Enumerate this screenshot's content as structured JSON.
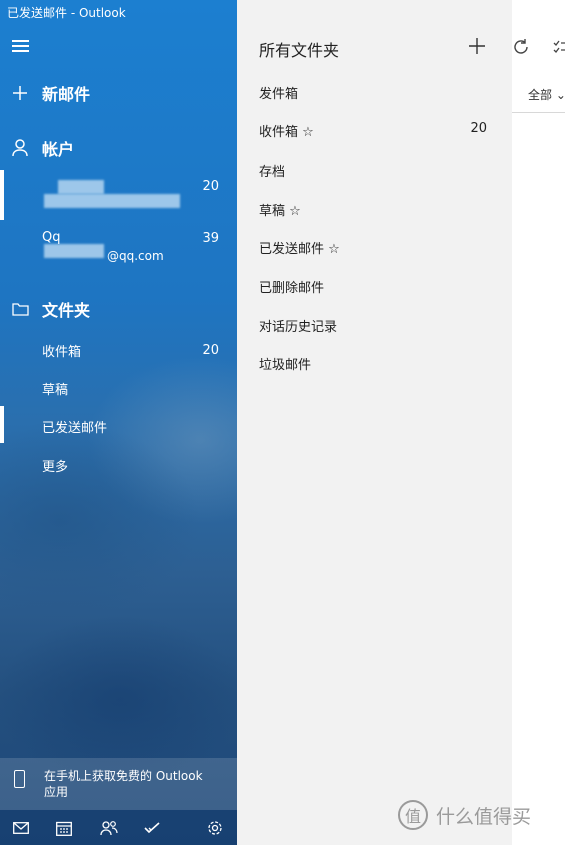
{
  "window": {
    "title": "已发送邮件 - Outlook"
  },
  "nav": {
    "new_mail": "新邮件",
    "accounts_header": "帐户",
    "accounts": [
      {
        "name": "",
        "count": "20"
      },
      {
        "name": "Qq",
        "email": "@qq.com",
        "count": "39"
      }
    ],
    "folders_header": "文件夹",
    "folders": [
      {
        "label": "收件箱",
        "count": "20"
      },
      {
        "label": "草稿",
        "count": ""
      },
      {
        "label": "已发送邮件",
        "count": "",
        "selected": true
      },
      {
        "label": "更多",
        "count": ""
      }
    ],
    "promo": {
      "line1": "在手机上获取免费的 Outlook",
      "line2": "应用"
    },
    "bottom_icons": [
      "mail-icon",
      "calendar-icon",
      "people-icon",
      "todo-icon",
      "settings-icon"
    ]
  },
  "all_folders": {
    "header": "所有文件夹",
    "items": [
      {
        "label": "发件箱",
        "count": ""
      },
      {
        "label": "收件箱 ☆",
        "count": "20"
      },
      {
        "label": "存档",
        "count": ""
      },
      {
        "label": "草稿 ☆",
        "count": ""
      },
      {
        "label": "已发送邮件 ☆",
        "count": ""
      },
      {
        "label": "已删除邮件",
        "count": ""
      },
      {
        "label": "对话历史记录",
        "count": ""
      },
      {
        "label": "垃圾邮件",
        "count": ""
      }
    ]
  },
  "right_pane": {
    "filter_label": "全部"
  },
  "watermark": {
    "text": "什么值得买",
    "logo_char": "值"
  },
  "colors": {
    "nav_blue": "#1e75c2",
    "flyout_bg": "#f2f2f2"
  }
}
